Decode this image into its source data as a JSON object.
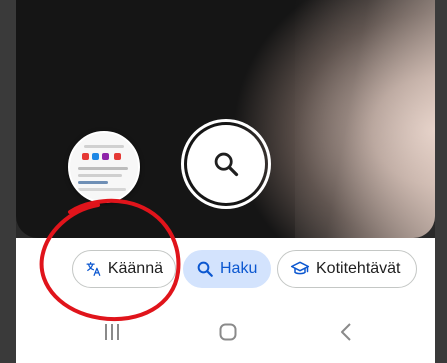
{
  "camera": {
    "shutter_icon": "search-icon",
    "thumbnail_label": "recent-screenshot-thumbnail"
  },
  "modes": [
    {
      "label": "Käännä",
      "icon": "translate-icon",
      "selected": false
    },
    {
      "label": "Haku",
      "icon": "search-icon",
      "selected": true
    },
    {
      "label": "Kotitehtävät",
      "icon": "graduation-cap-icon",
      "selected": false
    }
  ],
  "navbar": {
    "recent_icon": "recent-apps-icon",
    "home_icon": "home-icon",
    "back_icon": "back-icon"
  },
  "colors": {
    "accent": "#0b57d0",
    "accent_bg": "#d3e3fd",
    "annotation": "#e0141b"
  }
}
